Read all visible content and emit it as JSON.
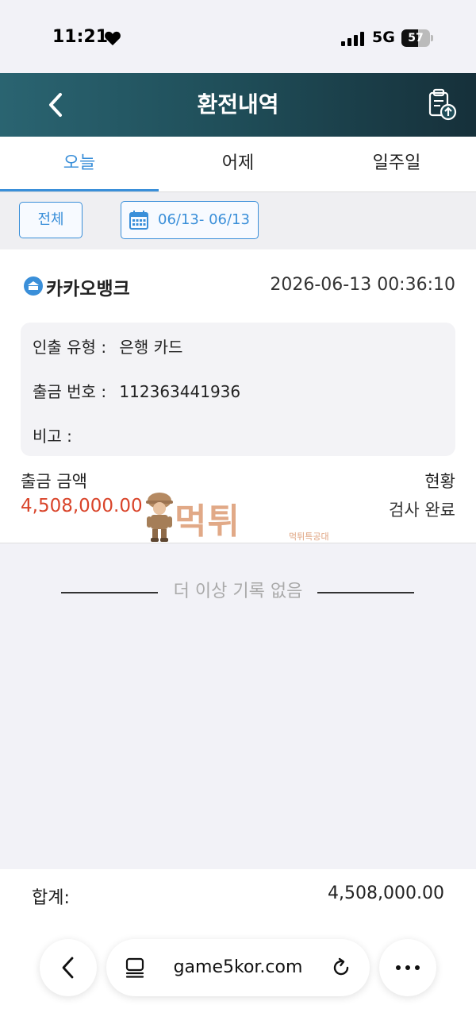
{
  "status_bar": {
    "time": "11:21",
    "network": "5G",
    "battery": "57",
    "battery_level": 0.57
  },
  "header": {
    "title": "환전내역"
  },
  "tabs": [
    {
      "label": "오늘",
      "active": true
    },
    {
      "label": "어제",
      "active": false
    },
    {
      "label": "일주일",
      "active": false
    }
  ],
  "filter": {
    "all_label": "전체",
    "date_range": "06/13- 06/13"
  },
  "record": {
    "bank": "카카오뱅크",
    "datetime": "2026-06-13 00:36:10",
    "type_label": "인출 유형 :",
    "type_value": "은행 카드",
    "number_label": "출금 번호 :",
    "number_value": "112363441936",
    "note_label": "비고 :",
    "amount_label": "출금 금액",
    "amount_value": "4,508,000.00",
    "status_label": "현황",
    "status_value": "검사 완료"
  },
  "watermark": {
    "text": "먹튀",
    "subtext": "먹튀특공대"
  },
  "end_message": "더 이상 기록 없음",
  "summary": {
    "total_label": "합계:",
    "total_value": "4,508,000.00"
  },
  "browser": {
    "url": "game5kor.com"
  },
  "colors": {
    "accent": "#3a8fd9",
    "header_start": "#2a6471",
    "header_end": "#16303a",
    "amount": "#d9442a"
  }
}
